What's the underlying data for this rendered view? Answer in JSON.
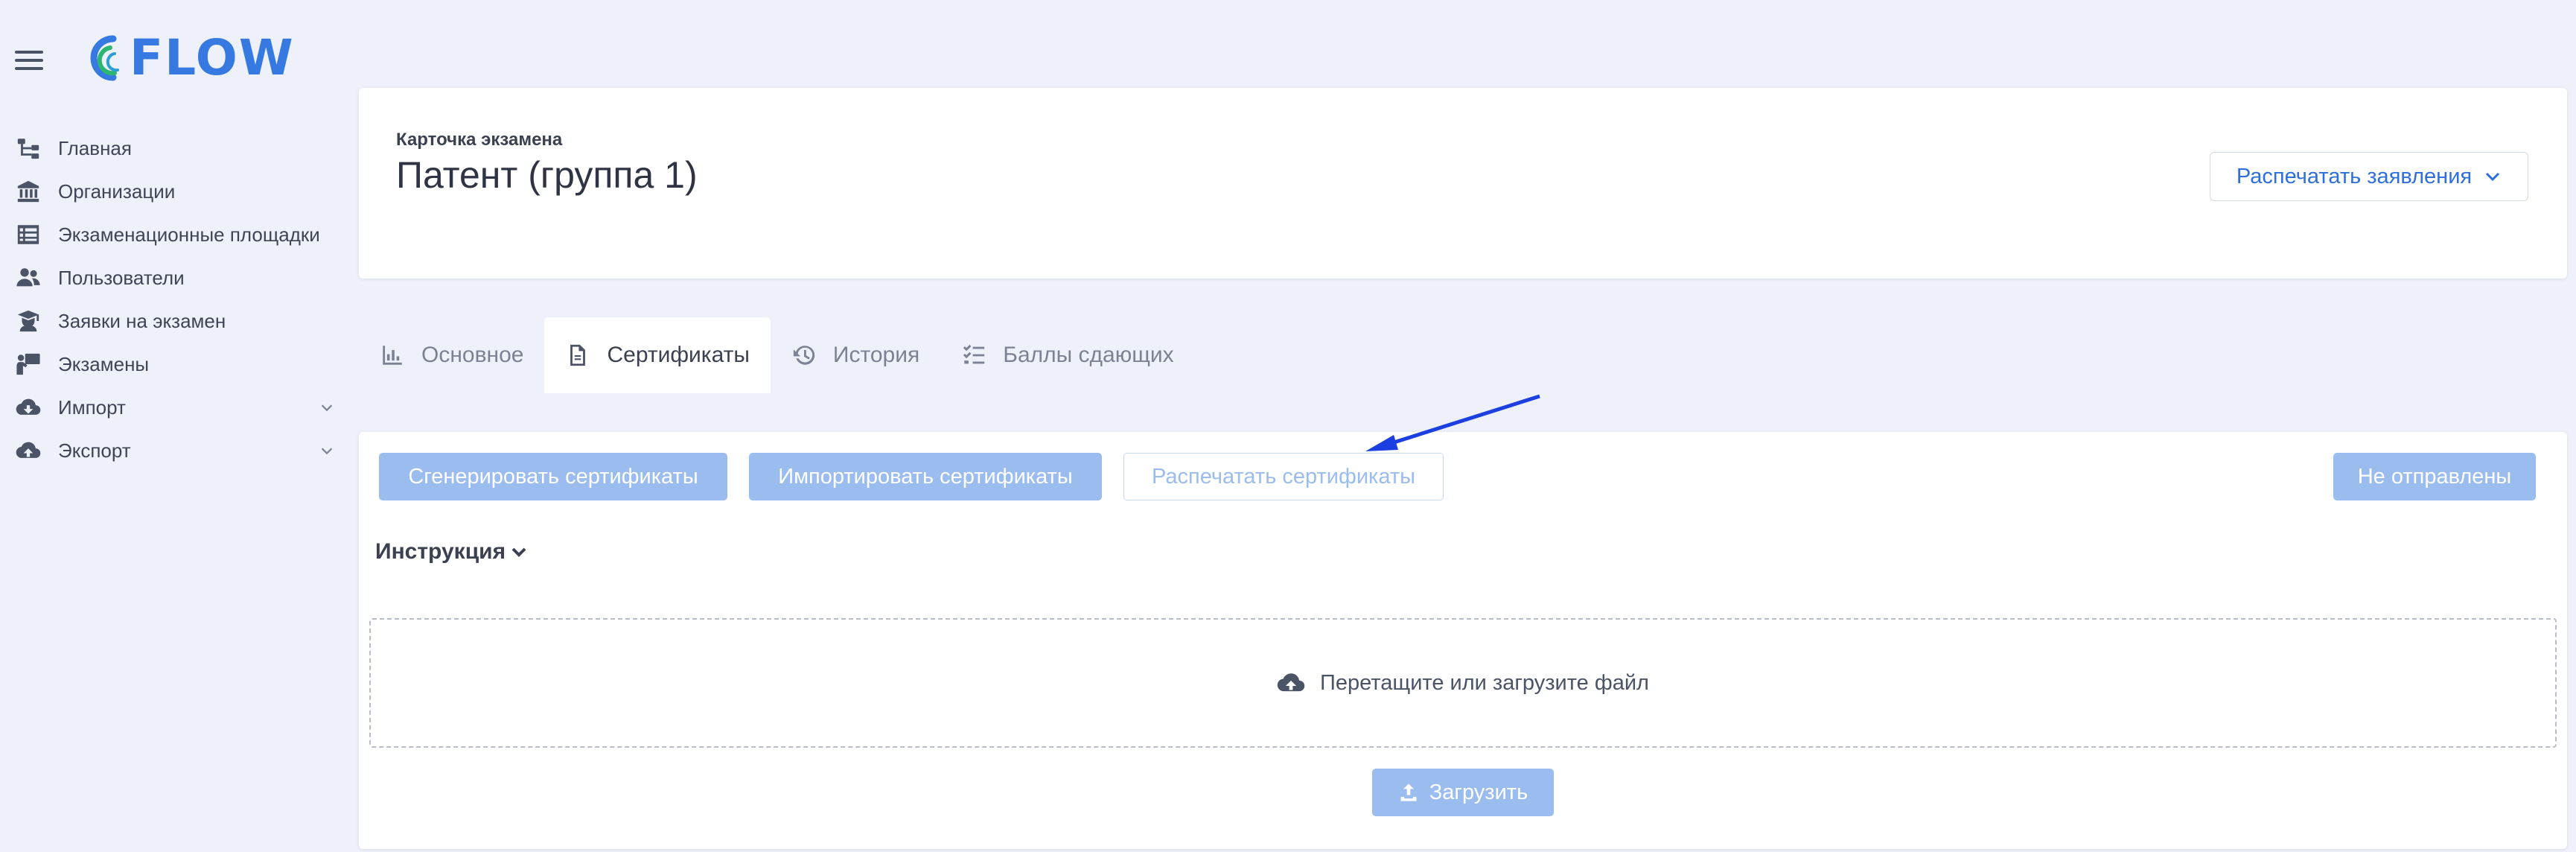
{
  "app": {
    "logo_text": "FLOW",
    "brand_color": "#3679e0"
  },
  "sidebar": {
    "items": [
      {
        "label": "Главная",
        "icon": "sitemap-icon"
      },
      {
        "label": "Организации",
        "icon": "bank-icon"
      },
      {
        "label": "Экзаменационные площадки",
        "icon": "list-icon"
      },
      {
        "label": "Пользователи",
        "icon": "users-icon"
      },
      {
        "label": "Заявки на экзамен",
        "icon": "graduate-icon"
      },
      {
        "label": "Экзамены",
        "icon": "presenter-icon"
      },
      {
        "label": "Импорт",
        "icon": "cloud-download-icon",
        "expandable": true
      },
      {
        "label": "Экспорт",
        "icon": "cloud-upload-icon",
        "expandable": true
      }
    ]
  },
  "header": {
    "subtitle": "Карточка экзамена",
    "title": "Патент (группа 1)",
    "print_applications_label": "Распечатать заявления"
  },
  "tabs": [
    {
      "label": "Основное",
      "icon": "chart-icon",
      "active": false
    },
    {
      "label": "Сертификаты",
      "icon": "document-icon",
      "active": true
    },
    {
      "label": "История",
      "icon": "history-icon",
      "active": false
    },
    {
      "label": "Баллы сдающих",
      "icon": "checklist-icon",
      "active": false
    }
  ],
  "certificates": {
    "generate_label": "Сгенерировать сертификаты",
    "import_label": "Импортировать сертификаты",
    "print_label": "Распечатать сертификаты",
    "not_sent_label": "Не отправлены",
    "instruction_label": "Инструкция",
    "dropzone_label": "Перетащите или загрузите файл",
    "upload_label": "Загрузить"
  },
  "colors": {
    "accent": "#2f6fdb",
    "disabled_primary": "#9bbcee",
    "background": "#eef1f9",
    "annotation_arrow": "#1b3fe0"
  }
}
